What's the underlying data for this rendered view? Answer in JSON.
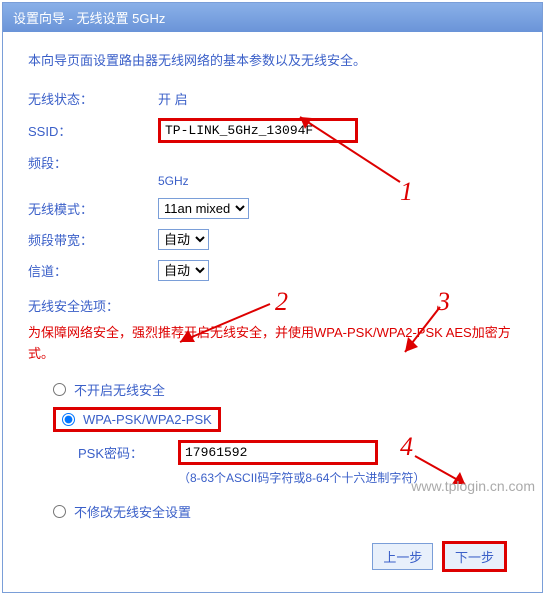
{
  "title": "设置向导 - 无线设置 5GHz",
  "intro": "本向导页面设置路由器无线网络的基本参数以及无线安全。",
  "fields": {
    "status_label": "无线状态：",
    "status_value": "开 启",
    "ssid_label": "SSID：",
    "ssid_value": "TP-LINK_5GHz_13094F",
    "band_label": "频段：",
    "band_value": "5GHz",
    "mode_label": "无线模式：",
    "mode_value": "11an mixed",
    "bandwidth_label": "频段带宽：",
    "bandwidth_value": "自动",
    "channel_label": "信道：",
    "channel_value": "自动"
  },
  "security": {
    "section_label": "无线安全选项：",
    "warning": "为保障网络安全，强烈推荐开启无线安全，并使用WPA-PSK/WPA2-PSK AES加密方式。",
    "option_none": "不开启无线安全",
    "option_wpa": "WPA-PSK/WPA2-PSK",
    "psk_label": "PSK密码：",
    "psk_value": "17961592",
    "psk_hint": "（8-63个ASCII码字符或8-64个十六进制字符）",
    "option_keep": "不修改无线安全设置"
  },
  "buttons": {
    "prev": "上一步",
    "next": "下一步"
  },
  "annotations": {
    "n1": "1",
    "n2": "2",
    "n3": "3",
    "n4": "4"
  },
  "watermark": "www.tplogin.cn.com"
}
